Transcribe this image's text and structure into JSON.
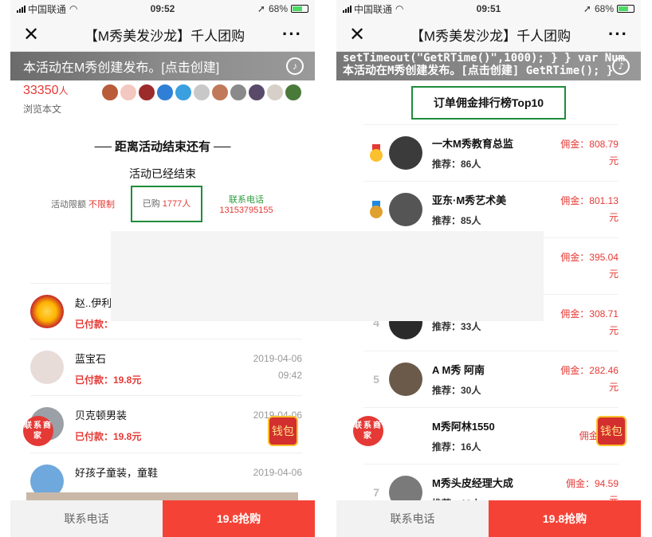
{
  "left": {
    "status": {
      "carrier": "中国联通",
      "time": "09:52",
      "battery": "68%"
    },
    "nav": {
      "title": "【M秀美发沙龙】千人团购"
    },
    "banner": "本活动在M秀创建发布。[点击创建]",
    "views": {
      "count": "33350",
      "unit": "人",
      "label": "浏览本文"
    },
    "countdown_title": "── 距离活动结束还有 ──",
    "ended": "活动已经结束",
    "limit": {
      "label": "活动限额",
      "value": "不限制"
    },
    "bought": {
      "label": "已购",
      "value": "1777人"
    },
    "phone": {
      "label": "联系电话",
      "value": "13153795155"
    },
    "buyers": [
      {
        "name": "赵..伊利",
        "paid": "已付款：",
        "date": "",
        "time": ""
      },
      {
        "name": "蓝宝石",
        "paid": "已付款：19.8元",
        "date": "2019-04-06",
        "time": "09:42"
      },
      {
        "name": "贝克顿男装",
        "paid": "已付款：19.8元",
        "date": "2019-04-06",
        "time": ""
      },
      {
        "name": "好孩子童装，童鞋",
        "paid": "",
        "date": "2019-04-06",
        "time": ""
      }
    ],
    "float_contact": "联系商家",
    "wallet": "钱包",
    "bottom": {
      "call": "联系电话",
      "buy": "19.8抢购"
    }
  },
  "right": {
    "status": {
      "carrier": "中国联通",
      "time": "09:51",
      "battery": "68%"
    },
    "nav": {
      "title": "【M秀美发沙龙】千人团购"
    },
    "code_line1": "setTimeout(\"GetRTime()\",1000); } } var Num",
    "code_line2": "本活动在M秀创建发布。[点击创建]  GetRTime(); }",
    "rank_title": "订单佣金排行榜Top10",
    "ranks": [
      {
        "rank": "",
        "name": "一木M秀教育总监",
        "rec": "推荐：86人",
        "com": "佣金：808.79",
        "unit": "元"
      },
      {
        "rank": "",
        "name": "亚东·M秀艺术美",
        "rec": "推荐：85人",
        "com": "佣金：801.13",
        "unit": "元"
      },
      {
        "rank": "",
        "name": "",
        "rec": "",
        "com": "佣金：395.04",
        "unit": "元"
      },
      {
        "rank": "4",
        "name": "",
        "rec": "推荐：33人",
        "com": "佣金：308.71",
        "unit": "元"
      },
      {
        "rank": "5",
        "name": "A M秀 阿南",
        "rec": "推荐：30人",
        "com": "佣金：282.46",
        "unit": "元"
      },
      {
        "rank": "",
        "name": "M秀阿林1550",
        "rec": "推荐：16人",
        "com": "佣金：14",
        "unit": ""
      },
      {
        "rank": "7",
        "name": "M秀头皮经理大成",
        "rec": "推荐：10人",
        "com": "佣金：94.59",
        "unit": "元"
      }
    ],
    "float_contact": "联系商家",
    "wallet": "钱包",
    "bottom": {
      "call": "联系电话",
      "buy": "19.8抢购"
    }
  }
}
